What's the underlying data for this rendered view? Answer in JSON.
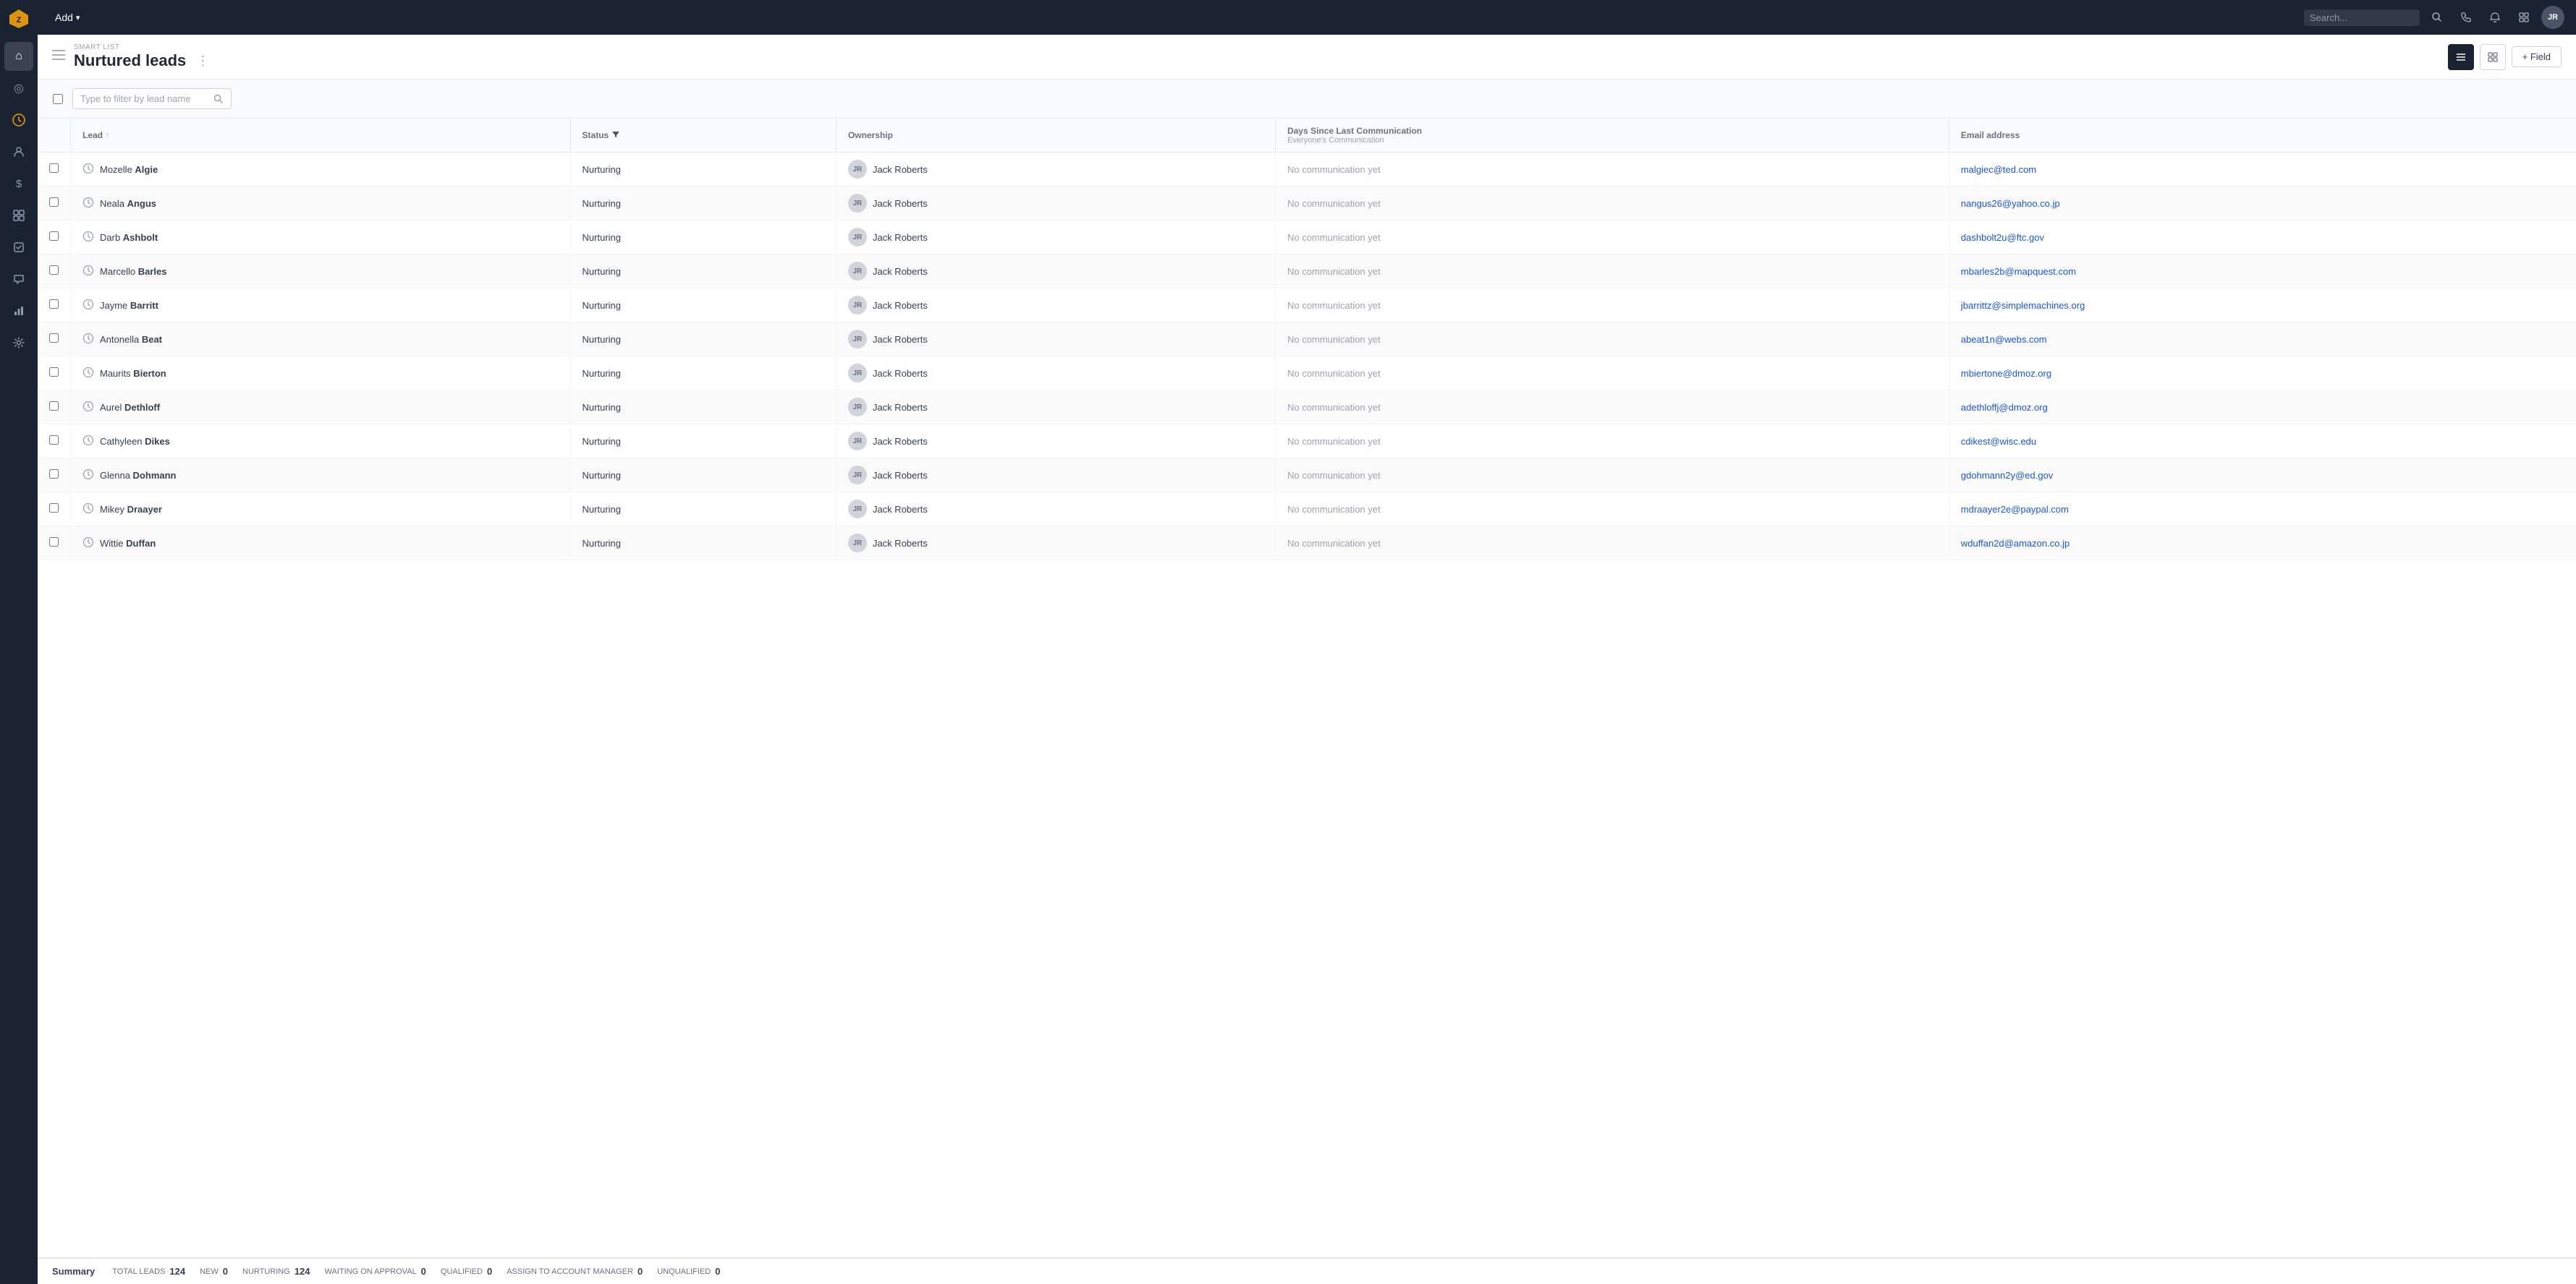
{
  "app": {
    "title": "Nurtured leads",
    "smart_list_label": "SMART LIST",
    "add_label": "Add",
    "more_options": "⋮",
    "avatar_initials": "JR"
  },
  "toolbar": {
    "add_field_label": "+ Field",
    "list_view_icon": "☰",
    "grid_view_icon": "⊞"
  },
  "filter": {
    "placeholder": "Type to filter by lead name",
    "search_icon": "🔍"
  },
  "table": {
    "columns": [
      {
        "key": "lead",
        "label": "Lead",
        "sortable": true
      },
      {
        "key": "status",
        "label": "Status",
        "filterable": true
      },
      {
        "key": "ownership",
        "label": "Ownership"
      },
      {
        "key": "days_since",
        "label": "Days Since Last Communication",
        "sublabel": "Everyone's Communication"
      },
      {
        "key": "email",
        "label": "Email address"
      }
    ],
    "rows": [
      {
        "id": 1,
        "first": "Mozelle",
        "last": "Algie",
        "status": "Nurturing",
        "owner_initials": "JR",
        "owner_name": "Jack Roberts",
        "communication": "No communication yet",
        "email": "malgiec@ted.com"
      },
      {
        "id": 2,
        "first": "Neala",
        "last": "Angus",
        "status": "Nurturing",
        "owner_initials": "JR",
        "owner_name": "Jack Roberts",
        "communication": "No communication yet",
        "email": "nangus26@yahoo.co.jp"
      },
      {
        "id": 3,
        "first": "Darb",
        "last": "Ashbolt",
        "status": "Nurturing",
        "owner_initials": "JR",
        "owner_name": "Jack Roberts",
        "communication": "No communication yet",
        "email": "dashbolt2u@ftc.gov"
      },
      {
        "id": 4,
        "first": "Marcello",
        "last": "Barles",
        "status": "Nurturing",
        "owner_initials": "JR",
        "owner_name": "Jack Roberts",
        "communication": "No communication yet",
        "email": "mbarles2b@mapquest.com"
      },
      {
        "id": 5,
        "first": "Jayme",
        "last": "Barritt",
        "status": "Nurturing",
        "owner_initials": "JR",
        "owner_name": "Jack Roberts",
        "communication": "No communication yet",
        "email": "jbarrittz@simplemachines.org"
      },
      {
        "id": 6,
        "first": "Antonella",
        "last": "Beat",
        "status": "Nurturing",
        "owner_initials": "JR",
        "owner_name": "Jack Roberts",
        "communication": "No communication yet",
        "email": "abeat1n@webs.com"
      },
      {
        "id": 7,
        "first": "Maurits",
        "last": "Bierton",
        "status": "Nurturing",
        "owner_initials": "JR",
        "owner_name": "Jack Roberts",
        "communication": "No communication yet",
        "email": "mbiertone@dmoz.org"
      },
      {
        "id": 8,
        "first": "Aurel",
        "last": "Dethloff",
        "status": "Nurturing",
        "owner_initials": "JR",
        "owner_name": "Jack Roberts",
        "communication": "No communication yet",
        "email": "adethloffj@dmoz.org"
      },
      {
        "id": 9,
        "first": "Cathyleen",
        "last": "Dikes",
        "status": "Nurturing",
        "owner_initials": "JR",
        "owner_name": "Jack Roberts",
        "communication": "No communication yet",
        "email": "cdikest@wisc.edu"
      },
      {
        "id": 10,
        "first": "Glenna",
        "last": "Dohmann",
        "status": "Nurturing",
        "owner_initials": "JR",
        "owner_name": "Jack Roberts",
        "communication": "No communication yet",
        "email": "gdohmann2y@ed.gov"
      },
      {
        "id": 11,
        "first": "Mikey",
        "last": "Draayer",
        "status": "Nurturing",
        "owner_initials": "JR",
        "owner_name": "Jack Roberts",
        "communication": "No communication yet",
        "email": "mdraayer2e@paypal.com"
      },
      {
        "id": 12,
        "first": "Wittie",
        "last": "Duffan",
        "status": "Nurturing",
        "owner_initials": "JR",
        "owner_name": "Jack Roberts",
        "communication": "No communication yet",
        "email": "wduffan2d@amazon.co.jp"
      }
    ]
  },
  "summary": {
    "label": "Summary",
    "items": [
      {
        "key": "TOTAL LEADS",
        "value": "124"
      },
      {
        "key": "NEW",
        "value": "0"
      },
      {
        "key": "NURTURING",
        "value": "124"
      },
      {
        "key": "WAITING ON APPROVAL",
        "value": "0"
      },
      {
        "key": "QUALIFIED",
        "value": "0"
      },
      {
        "key": "ASSIGN TO ACCOUNT MANAGER",
        "value": "0"
      },
      {
        "key": "UNQUALIFIED",
        "value": "0"
      }
    ]
  },
  "sidebar": {
    "icons": [
      {
        "name": "home-icon",
        "symbol": "⌂",
        "active": false
      },
      {
        "name": "target-icon",
        "symbol": "◎",
        "active": false
      },
      {
        "name": "leads-icon",
        "symbol": "↺",
        "active": true
      },
      {
        "name": "people-icon",
        "symbol": "👤",
        "active": false
      },
      {
        "name": "dollar-icon",
        "symbol": "$",
        "active": false
      },
      {
        "name": "dashboard-icon",
        "symbol": "▦",
        "active": false
      },
      {
        "name": "tasks-icon",
        "symbol": "✓",
        "active": false
      },
      {
        "name": "chat-icon",
        "symbol": "💬",
        "active": false
      },
      {
        "name": "reports-icon",
        "symbol": "📊",
        "active": false
      },
      {
        "name": "settings-icon",
        "symbol": "⚙",
        "active": false
      }
    ]
  }
}
